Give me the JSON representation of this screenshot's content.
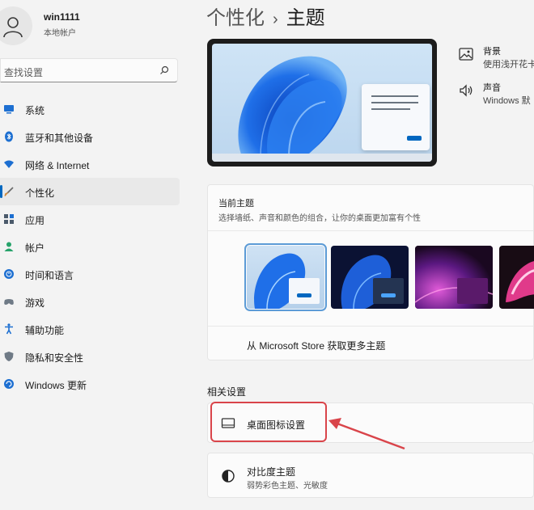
{
  "account": {
    "name": "win1111",
    "type": "本地帐户"
  },
  "search": {
    "placeholder": "查找设置"
  },
  "nav": {
    "items": [
      {
        "label": "系统",
        "icon": "monitor-icon",
        "color": "#1d6fd1"
      },
      {
        "label": "蓝牙和其他设备",
        "icon": "bluetooth-icon",
        "color": "#1d6fd1"
      },
      {
        "label": "网络 & Internet",
        "icon": "wifi-icon",
        "color": "#1d6fd1"
      },
      {
        "label": "个性化",
        "icon": "brush-icon",
        "color": "#d28b3c"
      },
      {
        "label": "应用",
        "icon": "apps-icon",
        "color": "#4b5a6b"
      },
      {
        "label": "帐户",
        "icon": "person-icon",
        "color": "#27a36b"
      },
      {
        "label": "时间和语言",
        "icon": "globe-clock-icon",
        "color": "#1d6fd1"
      },
      {
        "label": "游戏",
        "icon": "gamepad-icon",
        "color": "#6f7a86"
      },
      {
        "label": "辅助功能",
        "icon": "accessibility-icon",
        "color": "#1d6fd1"
      },
      {
        "label": "隐私和安全性",
        "icon": "shield-icon",
        "color": "#6f7a86"
      },
      {
        "label": "Windows 更新",
        "icon": "update-icon",
        "color": "#1d6fd1"
      }
    ],
    "active": "个性化"
  },
  "breadcrumb": {
    "parent": "个性化",
    "separator": "›",
    "current": "主题"
  },
  "side_options": {
    "background": {
      "title": "背景",
      "desc": "使用浅开花卡"
    },
    "sound": {
      "title": "声音",
      "desc": "Windows 默"
    }
  },
  "current_theme": {
    "title": "当前主题",
    "desc": "选择墙纸、声音和颜色的组合，让你的桌面更加富有个性",
    "store_link": "从 Microsoft Store 获取更多主题"
  },
  "related": {
    "heading": "相关设置",
    "desktop_icons": {
      "title": "桌面图标设置"
    },
    "contrast": {
      "title": "对比度主题",
      "desc": "弱势彩色主题、光敏度"
    }
  },
  "colors": {
    "accent": "#0067c0",
    "highlight": "#d9444a"
  }
}
